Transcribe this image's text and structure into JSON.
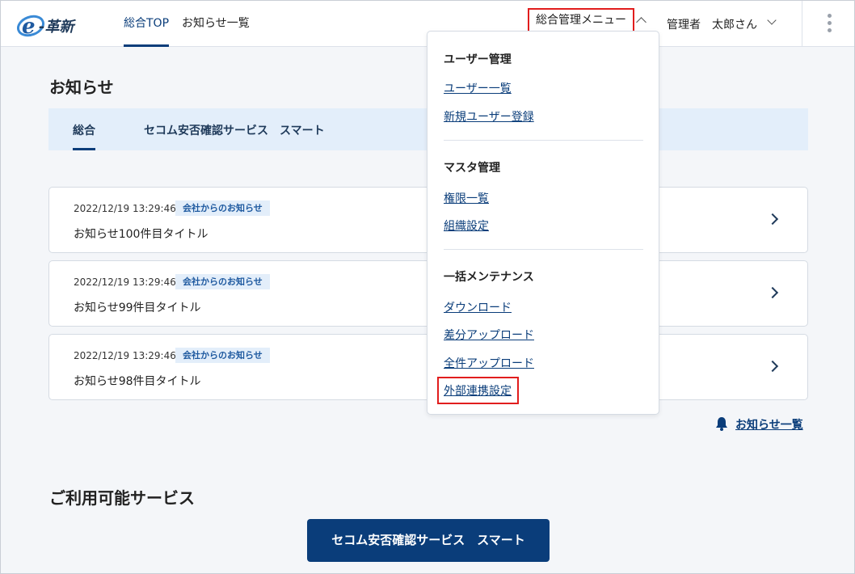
{
  "header": {
    "logo_text": "e-革新",
    "nav": [
      {
        "label": "総合TOP",
        "active": true
      },
      {
        "label": "お知らせ一覧",
        "active": false
      }
    ],
    "admin_menu_label": "総合管理メニュー",
    "user_role": "管理者",
    "user_name": "太郎さん",
    "icons": {
      "menu_toggle": "chevron-up-icon",
      "user_toggle": "chevron-down-icon",
      "more": "kebab-icon"
    }
  },
  "news": {
    "title": "お知らせ",
    "tabs": [
      {
        "label": "総合",
        "active": true
      },
      {
        "label": "セコム安否確認サービス　スマート",
        "active": false
      }
    ],
    "items": [
      {
        "date": "2022/12/19 13:29:46",
        "badge": "会社からのお知らせ",
        "title": "お知らせ100件目タイトル"
      },
      {
        "date": "2022/12/19 13:29:46",
        "badge": "会社からのお知らせ",
        "title": "お知らせ99件目タイトル"
      },
      {
        "date": "2022/12/19 13:29:46",
        "badge": "会社からのお知らせ",
        "title": "お知らせ98件目タイトル"
      }
    ],
    "list_link": "お知らせ一覧"
  },
  "services": {
    "title": "ご利用可能サービス",
    "button": "セコム安否確認サービス　スマート"
  },
  "dropdown": {
    "groups": [
      {
        "heading": "ユーザー管理",
        "links": [
          "ユーザー一覧",
          "新規ユーザー登録"
        ]
      },
      {
        "heading": "マスタ管理",
        "links": [
          "権限一覧",
          "組織設定"
        ]
      },
      {
        "heading": "一括メンテナンス",
        "links": [
          "ダウンロード",
          "差分アップロード",
          "全件アップロード",
          "外部連携設定"
        ]
      }
    ]
  },
  "colors": {
    "brand": "#0a3d7a",
    "highlight": "#e11d1d",
    "tab_bg": "#e3eefa",
    "page_bg": "#f4f6f9"
  }
}
